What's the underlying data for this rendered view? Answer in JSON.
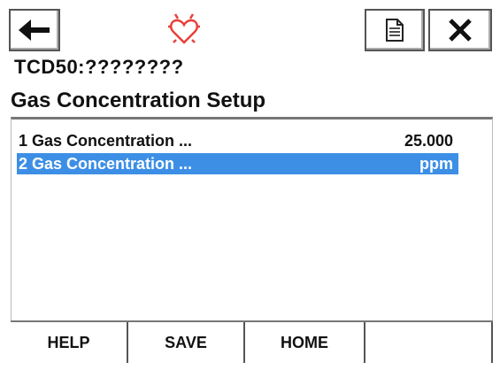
{
  "toolbar": {
    "back_icon": "left-arrow-icon",
    "status_icon": "heart-alarm-icon",
    "doc_icon": "document-icon",
    "close_icon": "close-x-icon",
    "status_color": "#e8403a"
  },
  "device": {
    "tag": "TCD50:????????"
  },
  "page": {
    "title": "Gas Concentration Setup"
  },
  "list": {
    "items": [
      {
        "label": "1 Gas Concentration ...",
        "value": "25.000",
        "selected": false
      },
      {
        "label": "2 Gas Concentration ...",
        "value": "ppm",
        "selected": true
      }
    ],
    "highlight_color": "#3d8fe6"
  },
  "softkeys": {
    "help_label": "HELP",
    "save_label": "SAVE",
    "home_label": "HOME",
    "fourth_label": ""
  }
}
